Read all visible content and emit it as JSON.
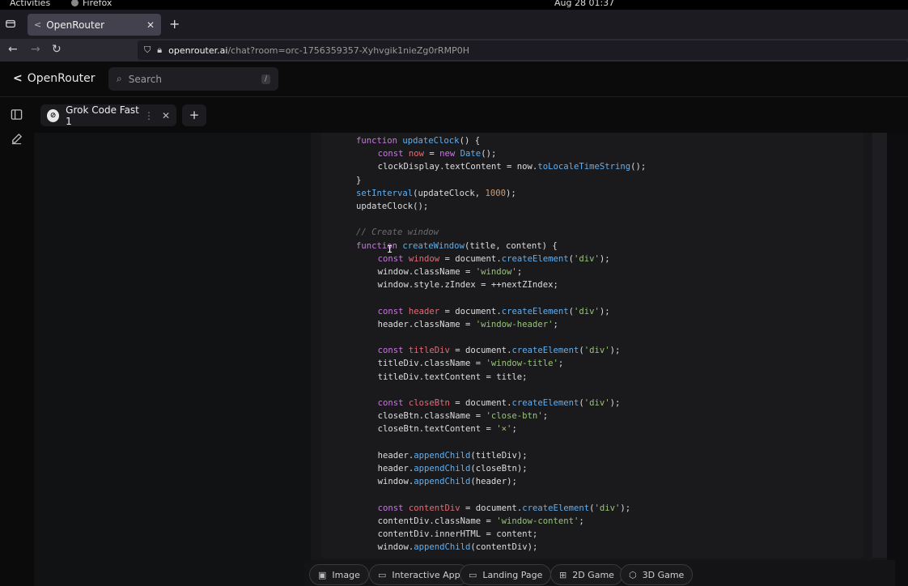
{
  "system": {
    "activities": "Activities",
    "app_name": "Firefox",
    "clock": "Aug 28  01:37"
  },
  "browser": {
    "tab_title": "OpenRouter",
    "url_host": "openrouter.ai",
    "url_path": "/chat?room=orc-1756359357-Xyhvgik1nieZg0rRMP0H"
  },
  "header": {
    "brand": "OpenRouter",
    "search_placeholder": "Search",
    "search_shortcut": "/"
  },
  "model_tab": {
    "label": "Grok Code Fast 1"
  },
  "code": [
    {
      "indent": 0,
      "tokens": [
        [
          "kw",
          "function "
        ],
        [
          "fn",
          "updateClock"
        ],
        [
          "",
          "() {"
        ]
      ]
    },
    {
      "indent": 1,
      "tokens": [
        [
          "kw",
          "const "
        ],
        [
          "var",
          "now"
        ],
        [
          "",
          " = "
        ],
        [
          "kw",
          "new "
        ],
        [
          "fn",
          "Date"
        ],
        [
          "",
          "();"
        ]
      ]
    },
    {
      "indent": 1,
      "tokens": [
        [
          "",
          "clockDisplay.textContent = now."
        ],
        [
          "fn",
          "toLocaleTimeString"
        ],
        [
          "",
          "();"
        ]
      ]
    },
    {
      "indent": 0,
      "tokens": [
        [
          "",
          "}"
        ]
      ]
    },
    {
      "indent": 0,
      "tokens": [
        [
          "fn",
          "setInterval"
        ],
        [
          "",
          "(updateClock, "
        ],
        [
          "num",
          "1000"
        ],
        [
          "",
          ");"
        ]
      ]
    },
    {
      "indent": 0,
      "tokens": [
        [
          "",
          "updateClock();"
        ]
      ]
    },
    {
      "indent": 0,
      "tokens": []
    },
    {
      "indent": 0,
      "tokens": [
        [
          "com",
          "// Create window"
        ]
      ]
    },
    {
      "indent": 0,
      "tokens": [
        [
          "kw",
          "function "
        ],
        [
          "fn",
          "createWindow"
        ],
        [
          "",
          "(title, content) {"
        ]
      ]
    },
    {
      "indent": 1,
      "tokens": [
        [
          "kw",
          "const "
        ],
        [
          "var",
          "window"
        ],
        [
          "",
          " = document."
        ],
        [
          "fn",
          "createElement"
        ],
        [
          "",
          "("
        ],
        [
          "str",
          "'div'"
        ],
        [
          "",
          ");"
        ]
      ]
    },
    {
      "indent": 1,
      "tokens": [
        [
          "",
          "window.className = "
        ],
        [
          "str",
          "'window'"
        ],
        [
          "",
          ";"
        ]
      ]
    },
    {
      "indent": 1,
      "tokens": [
        [
          "",
          "window.style.zIndex = ++nextZIndex;"
        ]
      ]
    },
    {
      "indent": 0,
      "tokens": []
    },
    {
      "indent": 1,
      "tokens": [
        [
          "kw",
          "const "
        ],
        [
          "var",
          "header"
        ],
        [
          "",
          " = document."
        ],
        [
          "fn",
          "createElement"
        ],
        [
          "",
          "("
        ],
        [
          "str",
          "'div'"
        ],
        [
          "",
          ");"
        ]
      ]
    },
    {
      "indent": 1,
      "tokens": [
        [
          "",
          "header.className = "
        ],
        [
          "str",
          "'window-header'"
        ],
        [
          "",
          ";"
        ]
      ]
    },
    {
      "indent": 0,
      "tokens": []
    },
    {
      "indent": 1,
      "tokens": [
        [
          "kw",
          "const "
        ],
        [
          "var",
          "titleDiv"
        ],
        [
          "",
          " = document."
        ],
        [
          "fn",
          "createElement"
        ],
        [
          "",
          "("
        ],
        [
          "str",
          "'div'"
        ],
        [
          "",
          ");"
        ]
      ]
    },
    {
      "indent": 1,
      "tokens": [
        [
          "",
          "titleDiv.className = "
        ],
        [
          "str",
          "'window-title'"
        ],
        [
          "",
          ";"
        ]
      ]
    },
    {
      "indent": 1,
      "tokens": [
        [
          "",
          "titleDiv.textContent = title;"
        ]
      ]
    },
    {
      "indent": 0,
      "tokens": []
    },
    {
      "indent": 1,
      "tokens": [
        [
          "kw",
          "const "
        ],
        [
          "var",
          "closeBtn"
        ],
        [
          "",
          " = document."
        ],
        [
          "fn",
          "createElement"
        ],
        [
          "",
          "("
        ],
        [
          "str",
          "'div'"
        ],
        [
          "",
          ");"
        ]
      ]
    },
    {
      "indent": 1,
      "tokens": [
        [
          "",
          "closeBtn.className = "
        ],
        [
          "str",
          "'close-btn'"
        ],
        [
          "",
          ";"
        ]
      ]
    },
    {
      "indent": 1,
      "tokens": [
        [
          "",
          "closeBtn.textContent = "
        ],
        [
          "str",
          "'×'"
        ],
        [
          "",
          ";"
        ]
      ]
    },
    {
      "indent": 0,
      "tokens": []
    },
    {
      "indent": 1,
      "tokens": [
        [
          "",
          "header."
        ],
        [
          "fn",
          "appendChild"
        ],
        [
          "",
          "(titleDiv);"
        ]
      ]
    },
    {
      "indent": 1,
      "tokens": [
        [
          "",
          "header."
        ],
        [
          "fn",
          "appendChild"
        ],
        [
          "",
          "(closeBtn);"
        ]
      ]
    },
    {
      "indent": 1,
      "tokens": [
        [
          "",
          "window."
        ],
        [
          "fn",
          "appendChild"
        ],
        [
          "",
          "(header);"
        ]
      ]
    },
    {
      "indent": 0,
      "tokens": []
    },
    {
      "indent": 1,
      "tokens": [
        [
          "kw",
          "const "
        ],
        [
          "var",
          "contentDiv"
        ],
        [
          "",
          " = document."
        ],
        [
          "fn",
          "createElement"
        ],
        [
          "",
          "("
        ],
        [
          "str",
          "'div'"
        ],
        [
          "",
          ");"
        ]
      ]
    },
    {
      "indent": 1,
      "tokens": [
        [
          "",
          "contentDiv.className = "
        ],
        [
          "str",
          "'window-content'"
        ],
        [
          "",
          ";"
        ]
      ]
    },
    {
      "indent": 1,
      "tokens": [
        [
          "",
          "contentDiv.innerHTML = content;"
        ]
      ]
    },
    {
      "indent": 1,
      "tokens": [
        [
          "",
          "window."
        ],
        [
          "fn",
          "appendChild"
        ],
        [
          "",
          "(contentDiv);"
        ]
      ]
    }
  ],
  "suggestions": [
    {
      "label": "Image",
      "icon": "image-icon"
    },
    {
      "label": "Interactive App",
      "icon": "app-window-icon"
    },
    {
      "label": "Landing Page",
      "icon": "monitor-icon"
    },
    {
      "label": "2D Game",
      "icon": "grid-icon"
    },
    {
      "label": "3D Game",
      "icon": "cube-icon"
    }
  ]
}
